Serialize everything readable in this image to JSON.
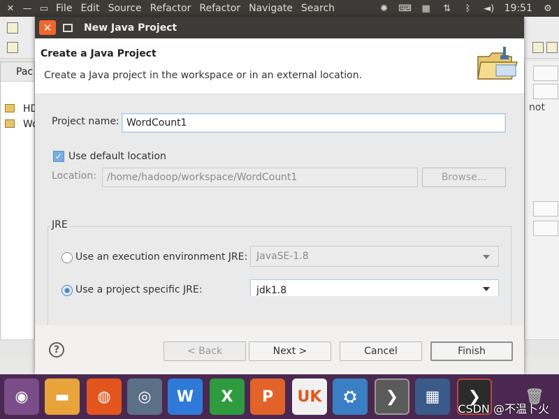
{
  "topbar": {
    "menus": [
      "File",
      "Edit",
      "Source",
      "Refactor",
      "Refactor",
      "Navigate",
      "Search"
    ],
    "clock": "19:51"
  },
  "eclipse": {
    "left_view_title": "Pac",
    "left_items": [
      "HD",
      "Wo"
    ],
    "right_text": "not"
  },
  "dialog": {
    "title": "New Java Project",
    "heading": "Create a Java Project",
    "description": "Create a Java project in the workspace or in an external location.",
    "project_name_label": "Project name:",
    "project_name_value": "WordCount1",
    "use_default_location_label": "Use default location",
    "use_default_location_checked": true,
    "location_label": "Location:",
    "location_value": "/home/hadoop/workspace/WordCount1",
    "browse_label": "Browse...",
    "jre_group_label": "JRE",
    "jre_exec_env_label": "Use an execution environment JRE:",
    "jre_exec_env_value": "JavaSE-1.8",
    "jre_specific_label": "Use a project specific JRE:",
    "jre_specific_value": "jdk1.8",
    "selected_jre_option": "project-specific",
    "buttons": {
      "back": "< Back",
      "next": "Next >",
      "cancel": "Cancel",
      "finish": "Finish"
    }
  },
  "watermark": "CSDN @不温卜火",
  "colors": {
    "titlebar": "#3c3b37",
    "close_button": "#f0672d",
    "dock": "#4a2850",
    "checkbox": "#7aaee0"
  }
}
